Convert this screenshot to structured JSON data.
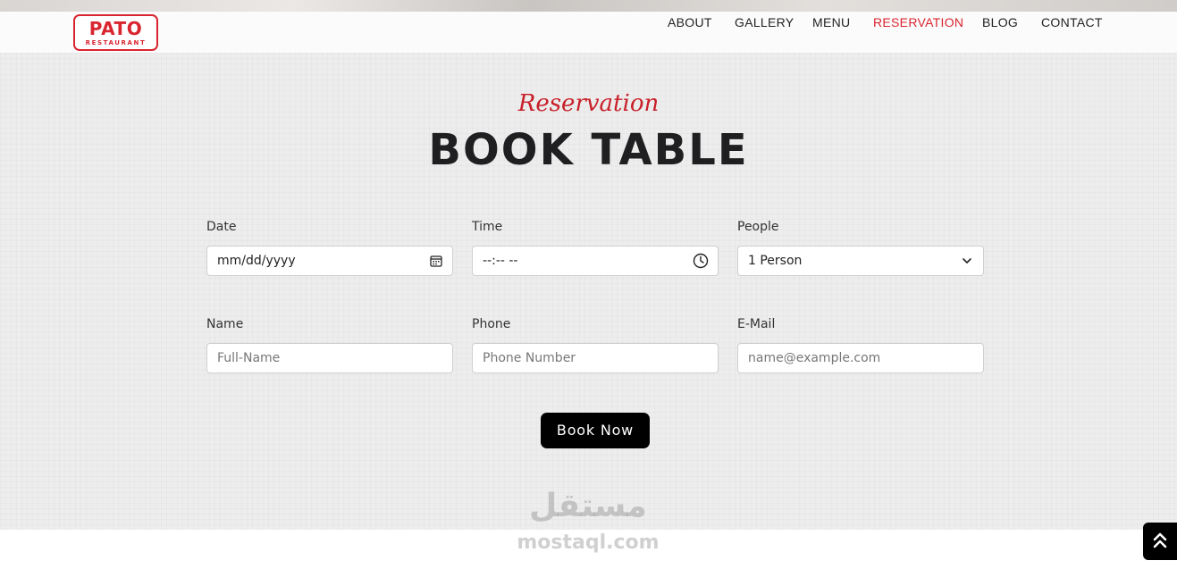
{
  "brand": {
    "name": "PATO",
    "sub": "RESTAURANT",
    "color": "#d9252f"
  },
  "nav": {
    "items": [
      "ABOUT",
      "GALLERY",
      "MENU",
      "RESERVATION",
      "BLOG",
      "CONTACT"
    ],
    "active": "RESERVATION"
  },
  "hero": {
    "subtitle": "Reservation",
    "title": "BOOK TABLE"
  },
  "form": {
    "date": {
      "label": "Date",
      "value": "mm/dd/yyyy",
      "icon": "calendar-icon"
    },
    "time": {
      "label": "Time",
      "value": "--:-- --",
      "icon": "clock-icon"
    },
    "people": {
      "label": "People",
      "value": "1 Person",
      "icon": "chevron-down-icon"
    },
    "name": {
      "label": "Name",
      "placeholder": "Full-Name"
    },
    "phone": {
      "label": "Phone",
      "placeholder": "Phone Number"
    },
    "email": {
      "label": "E-Mail",
      "placeholder": "name@example.com"
    },
    "submit_label": "Book Now"
  },
  "watermark": {
    "arabic": "مستقل",
    "latin": "mostaql.com"
  },
  "scroll_top_icon": "double-chevron-up-icon"
}
